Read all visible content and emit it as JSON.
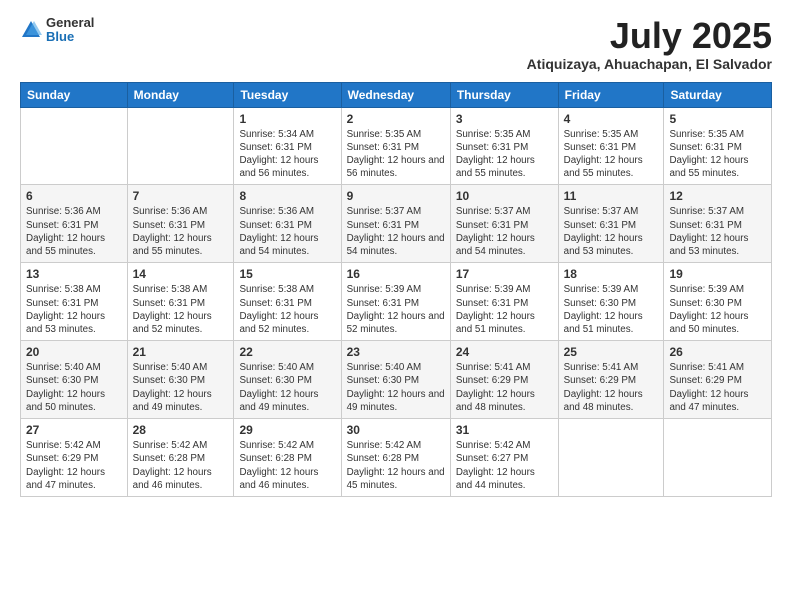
{
  "header": {
    "logo": {
      "line1": "General",
      "line2": "Blue"
    },
    "title": "July 2025",
    "location": "Atiquizaya, Ahuachapan, El Salvador"
  },
  "weekdays": [
    "Sunday",
    "Monday",
    "Tuesday",
    "Wednesday",
    "Thursday",
    "Friday",
    "Saturday"
  ],
  "weeks": [
    [
      {
        "day": "",
        "info": ""
      },
      {
        "day": "",
        "info": ""
      },
      {
        "day": "1",
        "info": "Sunrise: 5:34 AM\nSunset: 6:31 PM\nDaylight: 12 hours and 56 minutes."
      },
      {
        "day": "2",
        "info": "Sunrise: 5:35 AM\nSunset: 6:31 PM\nDaylight: 12 hours and 56 minutes."
      },
      {
        "day": "3",
        "info": "Sunrise: 5:35 AM\nSunset: 6:31 PM\nDaylight: 12 hours and 55 minutes."
      },
      {
        "day": "4",
        "info": "Sunrise: 5:35 AM\nSunset: 6:31 PM\nDaylight: 12 hours and 55 minutes."
      },
      {
        "day": "5",
        "info": "Sunrise: 5:35 AM\nSunset: 6:31 PM\nDaylight: 12 hours and 55 minutes."
      }
    ],
    [
      {
        "day": "6",
        "info": "Sunrise: 5:36 AM\nSunset: 6:31 PM\nDaylight: 12 hours and 55 minutes."
      },
      {
        "day": "7",
        "info": "Sunrise: 5:36 AM\nSunset: 6:31 PM\nDaylight: 12 hours and 55 minutes."
      },
      {
        "day": "8",
        "info": "Sunrise: 5:36 AM\nSunset: 6:31 PM\nDaylight: 12 hours and 54 minutes."
      },
      {
        "day": "9",
        "info": "Sunrise: 5:37 AM\nSunset: 6:31 PM\nDaylight: 12 hours and 54 minutes."
      },
      {
        "day": "10",
        "info": "Sunrise: 5:37 AM\nSunset: 6:31 PM\nDaylight: 12 hours and 54 minutes."
      },
      {
        "day": "11",
        "info": "Sunrise: 5:37 AM\nSunset: 6:31 PM\nDaylight: 12 hours and 53 minutes."
      },
      {
        "day": "12",
        "info": "Sunrise: 5:37 AM\nSunset: 6:31 PM\nDaylight: 12 hours and 53 minutes."
      }
    ],
    [
      {
        "day": "13",
        "info": "Sunrise: 5:38 AM\nSunset: 6:31 PM\nDaylight: 12 hours and 53 minutes."
      },
      {
        "day": "14",
        "info": "Sunrise: 5:38 AM\nSunset: 6:31 PM\nDaylight: 12 hours and 52 minutes."
      },
      {
        "day": "15",
        "info": "Sunrise: 5:38 AM\nSunset: 6:31 PM\nDaylight: 12 hours and 52 minutes."
      },
      {
        "day": "16",
        "info": "Sunrise: 5:39 AM\nSunset: 6:31 PM\nDaylight: 12 hours and 52 minutes."
      },
      {
        "day": "17",
        "info": "Sunrise: 5:39 AM\nSunset: 6:31 PM\nDaylight: 12 hours and 51 minutes."
      },
      {
        "day": "18",
        "info": "Sunrise: 5:39 AM\nSunset: 6:30 PM\nDaylight: 12 hours and 51 minutes."
      },
      {
        "day": "19",
        "info": "Sunrise: 5:39 AM\nSunset: 6:30 PM\nDaylight: 12 hours and 50 minutes."
      }
    ],
    [
      {
        "day": "20",
        "info": "Sunrise: 5:40 AM\nSunset: 6:30 PM\nDaylight: 12 hours and 50 minutes."
      },
      {
        "day": "21",
        "info": "Sunrise: 5:40 AM\nSunset: 6:30 PM\nDaylight: 12 hours and 49 minutes."
      },
      {
        "day": "22",
        "info": "Sunrise: 5:40 AM\nSunset: 6:30 PM\nDaylight: 12 hours and 49 minutes."
      },
      {
        "day": "23",
        "info": "Sunrise: 5:40 AM\nSunset: 6:30 PM\nDaylight: 12 hours and 49 minutes."
      },
      {
        "day": "24",
        "info": "Sunrise: 5:41 AM\nSunset: 6:29 PM\nDaylight: 12 hours and 48 minutes."
      },
      {
        "day": "25",
        "info": "Sunrise: 5:41 AM\nSunset: 6:29 PM\nDaylight: 12 hours and 48 minutes."
      },
      {
        "day": "26",
        "info": "Sunrise: 5:41 AM\nSunset: 6:29 PM\nDaylight: 12 hours and 47 minutes."
      }
    ],
    [
      {
        "day": "27",
        "info": "Sunrise: 5:42 AM\nSunset: 6:29 PM\nDaylight: 12 hours and 47 minutes."
      },
      {
        "day": "28",
        "info": "Sunrise: 5:42 AM\nSunset: 6:28 PM\nDaylight: 12 hours and 46 minutes."
      },
      {
        "day": "29",
        "info": "Sunrise: 5:42 AM\nSunset: 6:28 PM\nDaylight: 12 hours and 46 minutes."
      },
      {
        "day": "30",
        "info": "Sunrise: 5:42 AM\nSunset: 6:28 PM\nDaylight: 12 hours and 45 minutes."
      },
      {
        "day": "31",
        "info": "Sunrise: 5:42 AM\nSunset: 6:27 PM\nDaylight: 12 hours and 44 minutes."
      },
      {
        "day": "",
        "info": ""
      },
      {
        "day": "",
        "info": ""
      }
    ]
  ]
}
